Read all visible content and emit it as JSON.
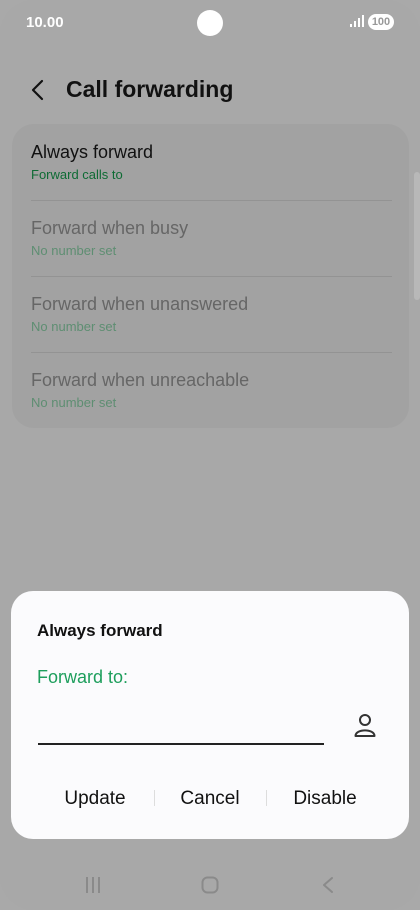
{
  "status_bar": {
    "time": "10.00",
    "battery": "100"
  },
  "header": {
    "title": "Call forwarding",
    "back_icon": "chevron-left-icon"
  },
  "settings": {
    "items": [
      {
        "label": "Always forward",
        "sub": "Forward calls to"
      },
      {
        "label": "Forward when busy",
        "sub": "No number set"
      },
      {
        "label": "Forward when unanswered",
        "sub": "No number set"
      },
      {
        "label": "Forward when unreachable",
        "sub": "No number set"
      }
    ]
  },
  "dialog": {
    "title": "Always forward",
    "field_label": "Forward to:",
    "input_value": "",
    "contact_icon": "person-icon",
    "buttons": {
      "update": "Update",
      "cancel": "Cancel",
      "disable": "Disable"
    }
  },
  "navigation": {
    "recents_icon": "recents-icon",
    "home_icon": "home-icon",
    "back_icon": "back-icon"
  },
  "colors": {
    "accent_green": "#1d9e5c",
    "dialog_bg": "#fbfbfd",
    "scrim": "#a8a8a8"
  }
}
